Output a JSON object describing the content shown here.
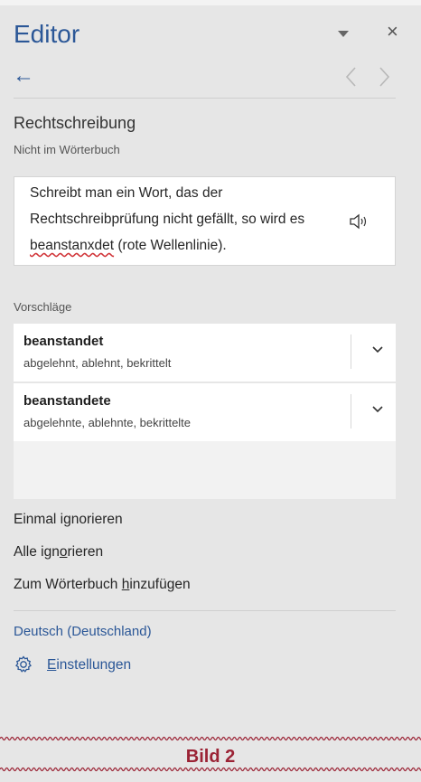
{
  "header": {
    "title": "Editor",
    "dropdown_icon": "dropdown-triangle-icon",
    "close_glyph": "×"
  },
  "nav": {
    "back_glyph": "←",
    "prev_glyph": "〈",
    "next_glyph": "〉"
  },
  "section": {
    "title": "Rechtschreibung",
    "subtitle": "Nicht im Wörterbuch"
  },
  "context": {
    "line1": "Schreibt man ein Wort, das der",
    "line2": "Rechtschreibprüfung nicht gefällt, so wird es",
    "error_word": "beanstanxdet",
    "line3_rest": " (rote Wellenlinie).",
    "speaker_icon": "speaker-icon"
  },
  "suggestions": {
    "label": "Vorschläge",
    "items": [
      {
        "word": "beanstandet",
        "synonyms": "abgelehnt, ablehnt, bekrittelt"
      },
      {
        "word": "beanstandete",
        "synonyms": "abgelehnte, ablehnte, bekrittelte"
      }
    ]
  },
  "actions": {
    "ignore_once": {
      "pre": "Einmal i",
      "u": "g",
      "post": "norieren"
    },
    "ignore_all": {
      "pre": "Alle ign",
      "u": "o",
      "post": "rieren"
    },
    "add_dict": {
      "pre": "Zum Wörterbuch ",
      "u": "h",
      "post": "inzufügen"
    }
  },
  "language": "Deutsch (Deutschland)",
  "settings": {
    "u": "E",
    "post": "instellungen",
    "icon": "gear-icon"
  },
  "footer": {
    "label": "Bild 2",
    "accent": "#9b2335"
  },
  "colors": {
    "accent": "#2b5797",
    "error": "#d13438"
  }
}
